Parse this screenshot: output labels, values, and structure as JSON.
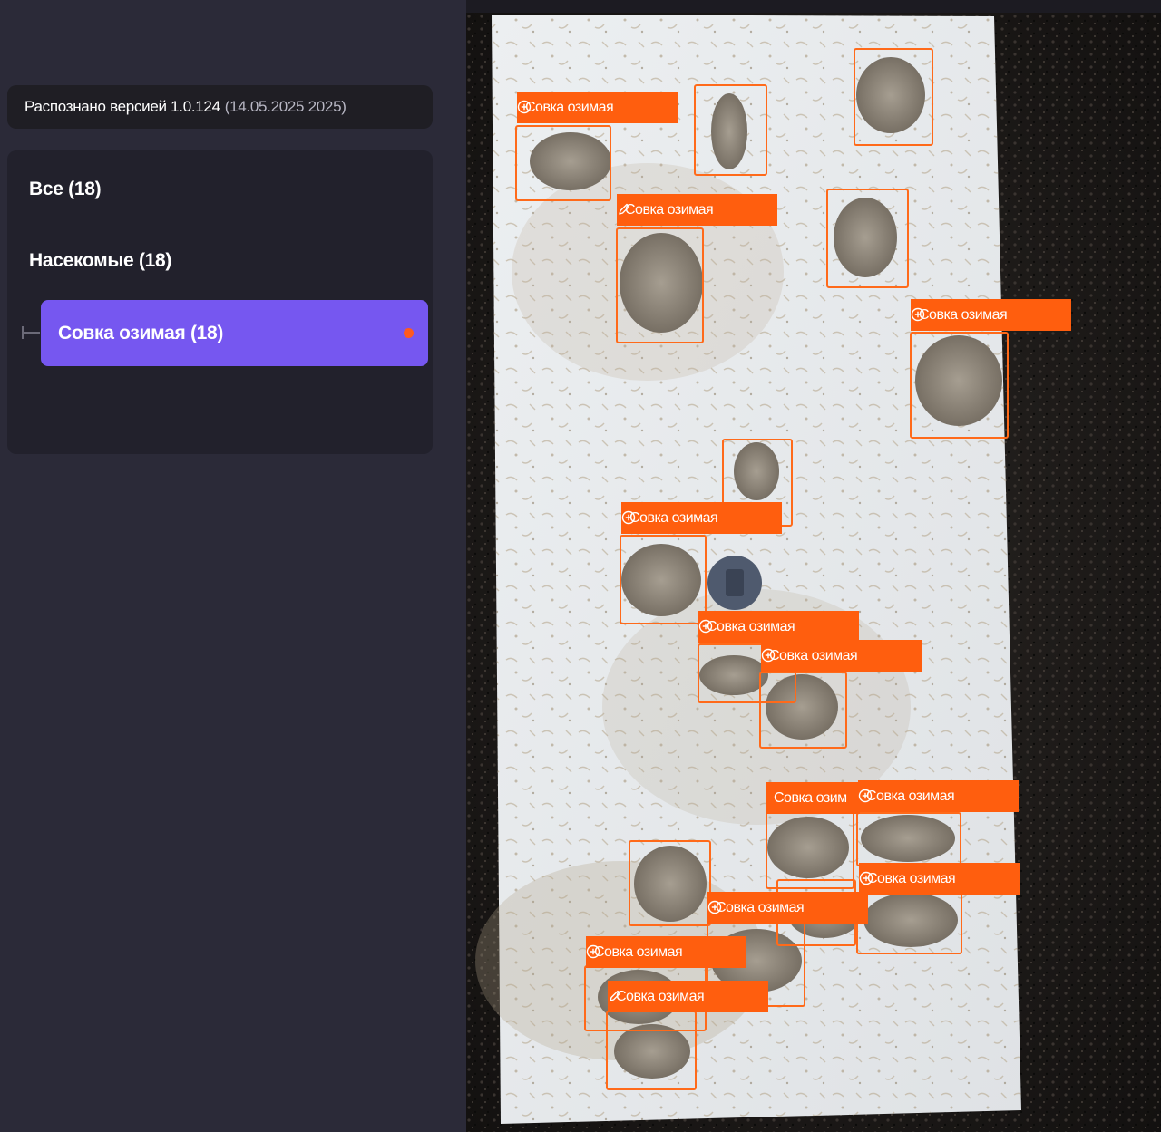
{
  "version": {
    "label": "Распознано версией 1.0.124",
    "date": "(14.05.2025 2025)"
  },
  "filters": {
    "all": "Все (18)",
    "insects": "Насекомые (18)",
    "selected": "Совка озимая (18)"
  },
  "colors": {
    "accent": "#7657f0",
    "detection": "#ff5e0e",
    "status_dot": "#ff5a1e"
  },
  "detections": {
    "label": "Совка озимая",
    "truncated_label": "Совка озим",
    "add_icon": "plus-circle-icon",
    "edit_icon": "pencil-icon"
  }
}
